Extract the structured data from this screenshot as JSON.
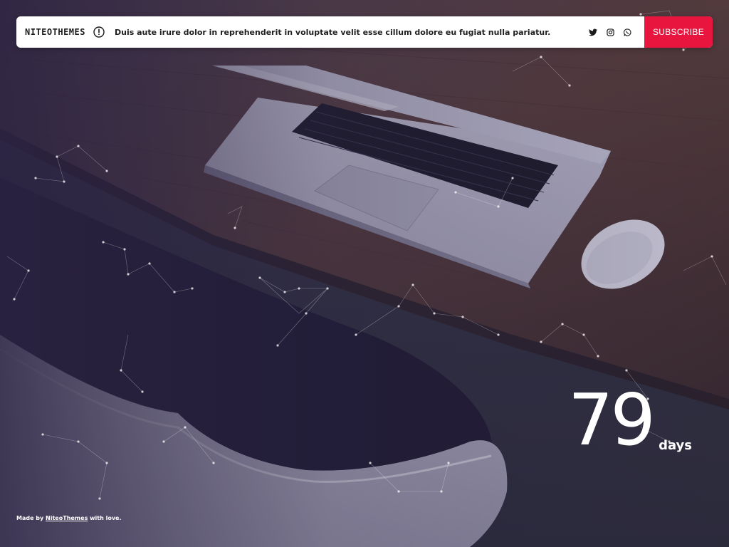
{
  "brand": {
    "logo_text": "NITEOTHEMES"
  },
  "announcement": {
    "text": "Duis aute irure dolor in reprehenderit in voluptate velit esse cillum dolore eu fugiat nulla pariatur.",
    "icon": "info-circle-icon"
  },
  "social": {
    "items": [
      {
        "name": "twitter",
        "icon": "twitter-icon"
      },
      {
        "name": "instagram",
        "icon": "instagram-icon"
      },
      {
        "name": "whatsapp",
        "icon": "whatsapp-icon"
      }
    ]
  },
  "subscribe": {
    "label": "SUBSCRIBE"
  },
  "countdown": {
    "value": "79",
    "unit": "days"
  },
  "footer": {
    "prefix": "Made by",
    "link_text": "NiteoThemes",
    "suffix": "with love."
  },
  "colors": {
    "accent": "#e8153f",
    "bar_bg": "#ffffff",
    "overlay": "#2a2442"
  }
}
